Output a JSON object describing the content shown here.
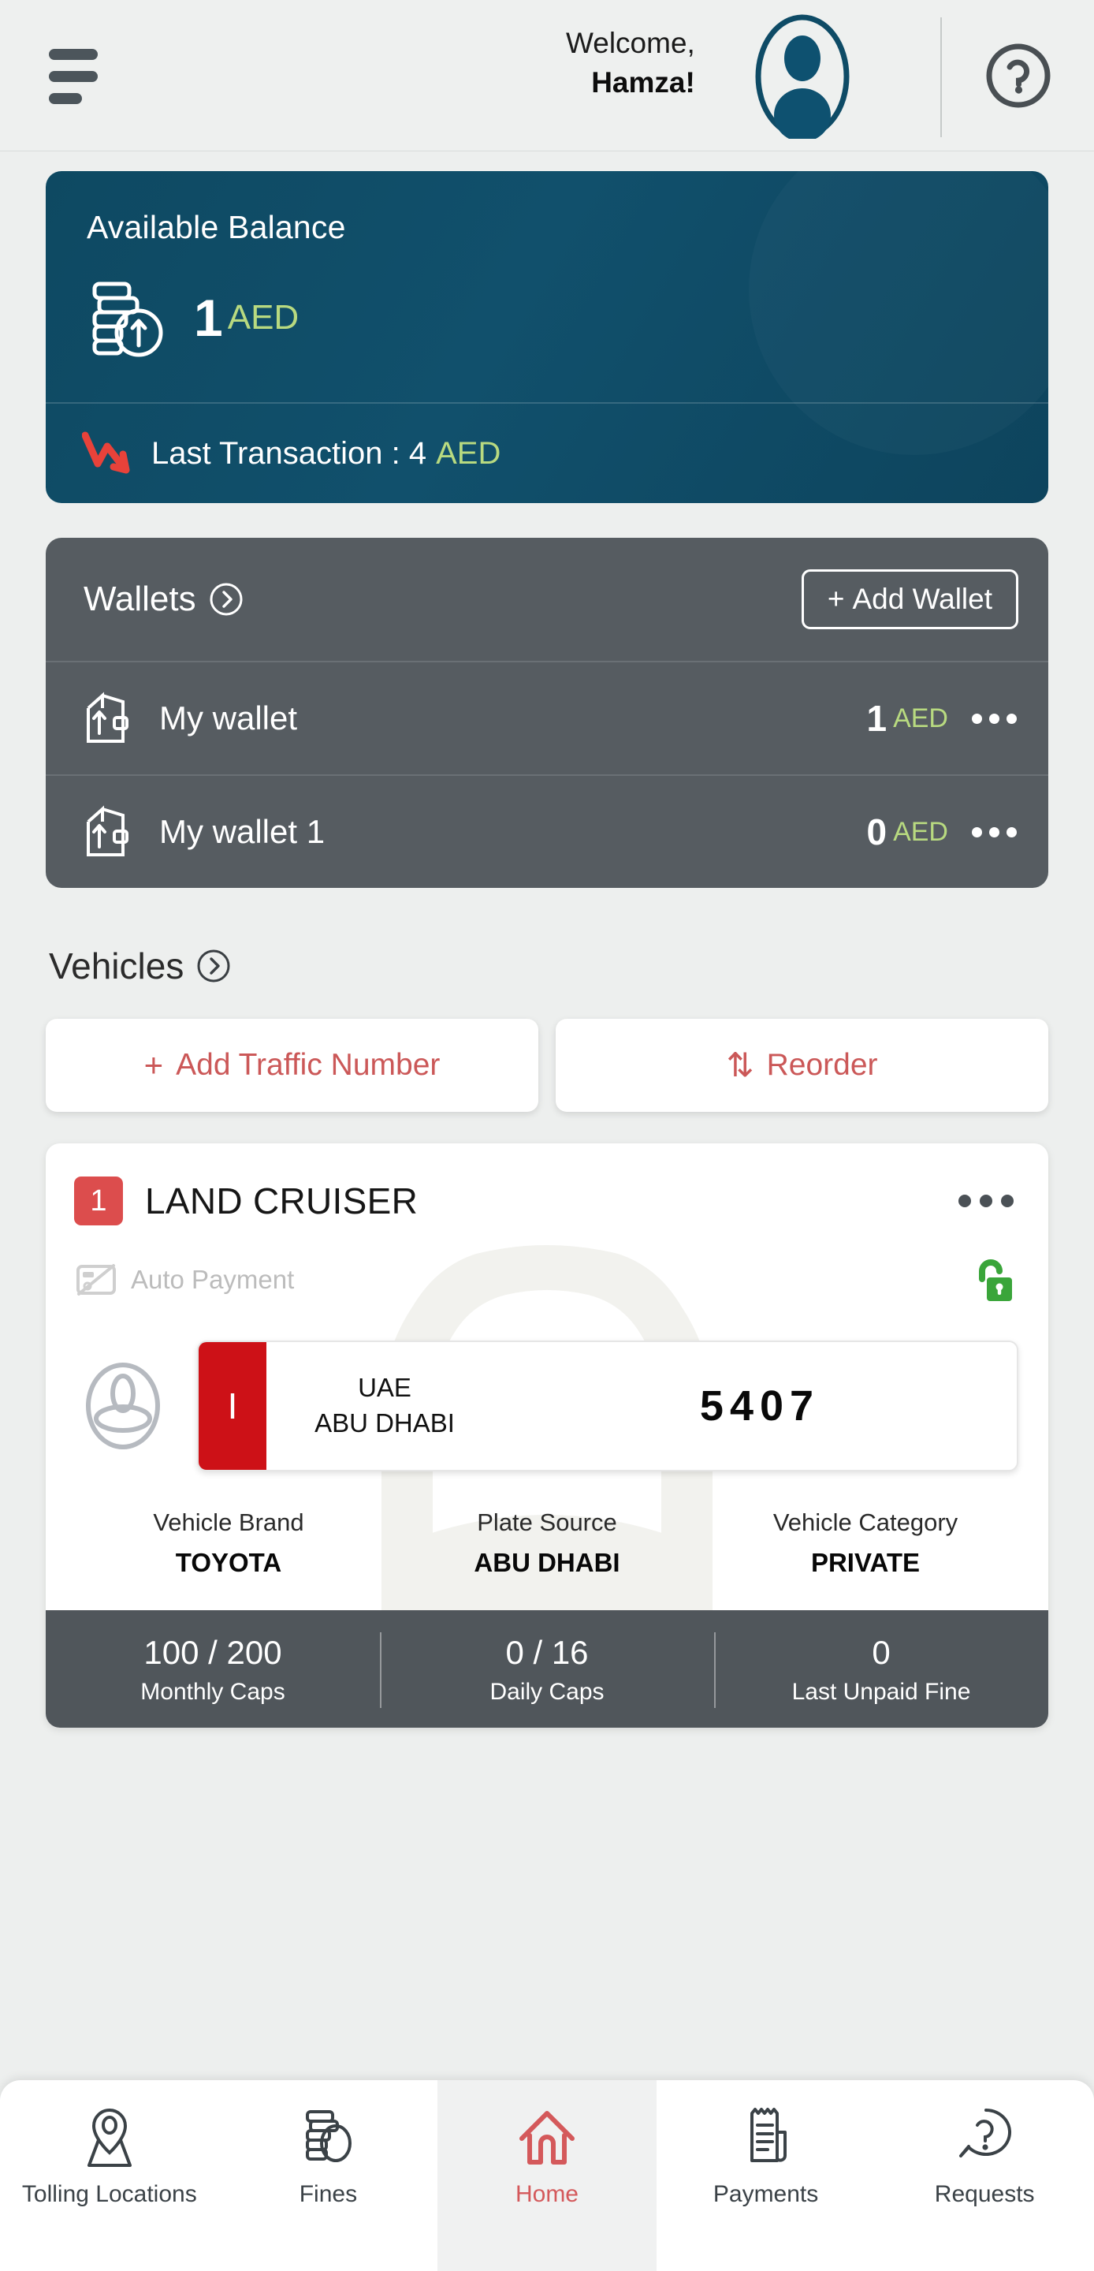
{
  "header": {
    "menu_icon": "hamburger-menu-icon",
    "welcome_line1": "Welcome,",
    "welcome_line2": "Hamza!",
    "avatar_icon": "user-avatar-icon",
    "help_icon": "help-circle-icon"
  },
  "balance": {
    "title": "Available Balance",
    "icon": "coins-stack-icon",
    "amount": "1",
    "currency": "AED",
    "last_tx_icon": "down-trend-arrow-icon",
    "last_tx_label": "Last Transaction : 4",
    "last_tx_currency": "AED"
  },
  "wallets": {
    "title": "Wallets",
    "chevron_icon": "chevron-right-circle-icon",
    "add_label": "Add Wallet",
    "add_plus": "+",
    "items": [
      {
        "icon": "wallet-icon",
        "name": "My wallet",
        "amount": "1",
        "currency": "AED",
        "more_icon": "more-horizontal-icon"
      },
      {
        "icon": "wallet-icon",
        "name": "My wallet 1",
        "amount": "0",
        "currency": "AED",
        "more_icon": "more-horizontal-icon"
      }
    ]
  },
  "vehicles": {
    "title": "Vehicles",
    "chevron_icon": "chevron-right-circle-icon",
    "add_traffic_label": "Add Traffic Number",
    "add_traffic_glyph": "+",
    "reorder_label": "Reorder",
    "reorder_glyph": "⇅",
    "card": {
      "badge": "1",
      "name": "LAND CRUISER",
      "more_icon": "more-horizontal-icon",
      "autopay_icon": "card-disabled-icon",
      "autopay_label": "Auto Payment",
      "lock_icon": "unlock-icon",
      "brand_logo_icon": "toyota-logo-icon",
      "plate": {
        "code": "I",
        "country": "UAE",
        "emirate": "ABU DHABI",
        "number": "5407"
      },
      "details": [
        {
          "label": "Vehicle Brand",
          "value": "TOYOTA"
        },
        {
          "label": "Plate Source",
          "value": "ABU DHABI"
        },
        {
          "label": "Vehicle Category",
          "value": "PRIVATE"
        }
      ],
      "stats": [
        {
          "value": "100 / 200",
          "label": "Monthly Caps"
        },
        {
          "value": "0 / 16",
          "label": "Daily Caps"
        },
        {
          "value": "0",
          "label": "Last Unpaid Fine"
        }
      ]
    }
  },
  "bottom_nav": {
    "items": [
      {
        "icon": "map-pin-icon",
        "label": "Tolling Locations",
        "active": false
      },
      {
        "icon": "coins-icon",
        "label": "Fines",
        "active": false
      },
      {
        "icon": "home-icon",
        "label": "Home",
        "active": true
      },
      {
        "icon": "receipt-icon",
        "label": "Payments",
        "active": false
      },
      {
        "icon": "question-chat-icon",
        "label": "Requests",
        "active": false
      }
    ]
  },
  "colors": {
    "balance_card": "#0e4962",
    "wallet_card": "#565c61",
    "accent_green": "#b8da80",
    "accent_red": "#cb5858",
    "badge_red": "#dc4d4d",
    "plate_red": "#cd1117",
    "lock_green": "#3aa53a",
    "stats_bar": "#50565b",
    "page_bg": "#edefee"
  }
}
